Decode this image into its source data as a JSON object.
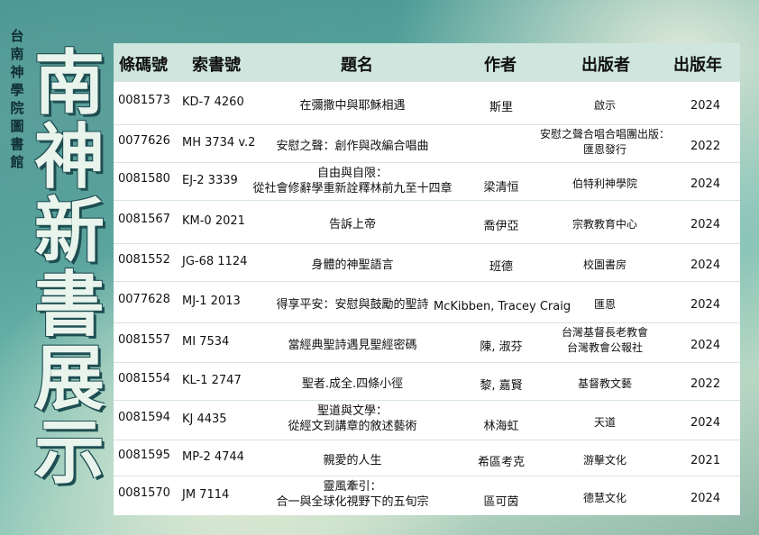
{
  "org_chars": [
    "台",
    "南",
    "神",
    "學",
    "院",
    "圖",
    "書",
    "館"
  ],
  "title_chars": [
    "南",
    "神",
    "新",
    "書",
    "展",
    "示"
  ],
  "headers": {
    "barcode": "條碼號",
    "call_no": "索書號",
    "title": "題名",
    "author": "作者",
    "publisher": "出版者",
    "year": "出版年"
  },
  "rows": [
    {
      "barcode": "0081573",
      "call_no": "KD-7 4260",
      "title": [
        "在彌撒中與耶穌相遇"
      ],
      "author": "斯里",
      "publisher": [
        "啟示"
      ],
      "year": "2024"
    },
    {
      "barcode": "0077626",
      "call_no": "MH 3734 v.2",
      "title": [
        "安慰之聲：創作與改編合唱曲"
      ],
      "author": "",
      "publisher": [
        "安慰之聲合唱合唱團出版：",
        "匯恩發行"
      ],
      "year": "2022"
    },
    {
      "barcode": "0081580",
      "call_no": "EJ-2 3339",
      "title": [
        "自由與自限：",
        "從社會修辭學重新詮釋林前九至十四章"
      ],
      "author": "梁清恒",
      "publisher": [
        "伯特利神學院"
      ],
      "year": "2024"
    },
    {
      "barcode": "0081567",
      "call_no": "KM-0 2021",
      "title": [
        "告訴上帝"
      ],
      "author": "喬伊亞",
      "publisher": [
        "宗教教育中心"
      ],
      "year": "2024"
    },
    {
      "barcode": "0081552",
      "call_no": "JG-68 1124",
      "title": [
        "身體的神聖語言"
      ],
      "author": "班德",
      "publisher": [
        "校園書房"
      ],
      "year": "2024"
    },
    {
      "barcode": "0077628",
      "call_no": "MJ-1 2013",
      "title": [
        "得享平安：安慰與鼓勵的聖詩"
      ],
      "author": "McKibben, Tracey Craig",
      "publisher": [
        "匯恩"
      ],
      "year": "2024"
    },
    {
      "barcode": "0081557",
      "call_no": "MI 7534",
      "title": [
        "當經典聖詩遇見聖經密碼"
      ],
      "author": "陳, 淑芬",
      "publisher": [
        "台灣基督長老教會",
        "台灣教會公報社"
      ],
      "year": "2024"
    },
    {
      "barcode": "0081554",
      "call_no": "KL-1 2747",
      "title": [
        "聖者.成全.四條小徑"
      ],
      "author": "黎, 嘉賢",
      "publisher": [
        "基督教文藝"
      ],
      "year": "2022"
    },
    {
      "barcode": "0081594",
      "call_no": "KJ 4435",
      "title": [
        "聖道與文學：",
        "從經文到講章的敘述藝術"
      ],
      "author": "林海虹",
      "publisher": [
        "天道"
      ],
      "year": "2024"
    },
    {
      "barcode": "0081595",
      "call_no": "MP-2 4744",
      "title": [
        "親愛的人生"
      ],
      "author": "希區考克",
      "publisher": [
        "游擊文化"
      ],
      "year": "2021"
    },
    {
      "barcode": "0081570",
      "call_no": "JM 7114",
      "title": [
        "靈風牽引：",
        "合一與全球化視野下的五旬宗"
      ],
      "author": "區可茵",
      "publisher": [
        "德慧文化"
      ],
      "year": "2024"
    }
  ]
}
